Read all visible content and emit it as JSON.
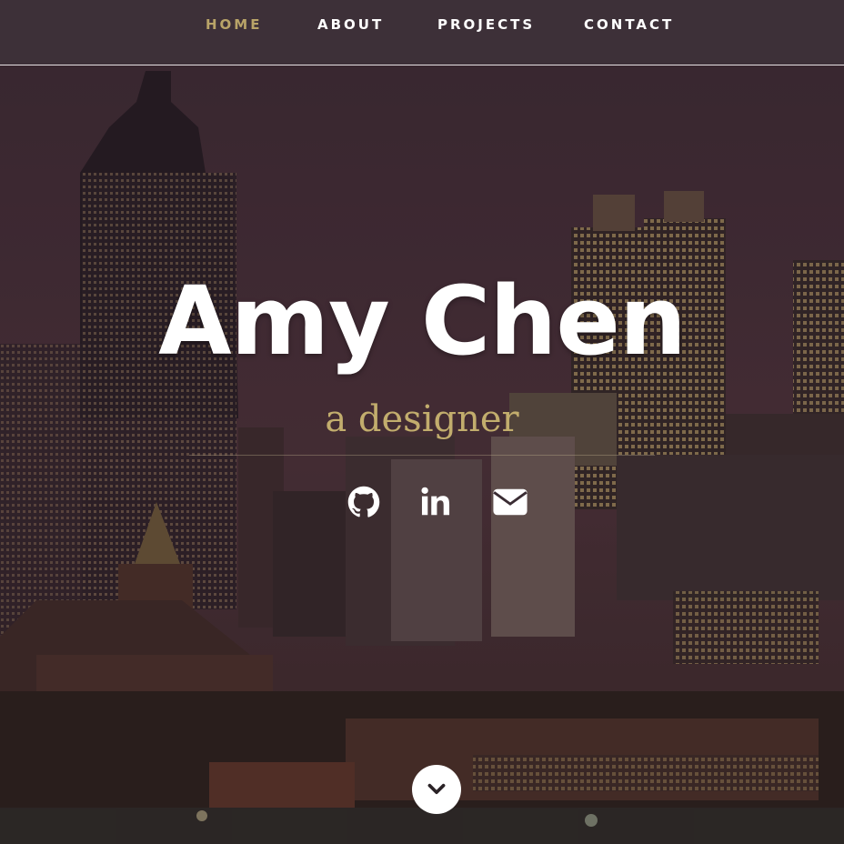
{
  "nav": {
    "items": [
      {
        "label": "HOME",
        "active": true
      },
      {
        "label": "ABOUT",
        "active": false
      },
      {
        "label": "PROJECTS",
        "active": false
      },
      {
        "label": "CONTACT",
        "active": false
      }
    ]
  },
  "hero": {
    "title": "Amy Chen",
    "subtitle": "a designer"
  },
  "social": [
    {
      "icon": "github-icon"
    },
    {
      "icon": "linkedin-icon"
    },
    {
      "icon": "email-icon"
    }
  ],
  "scroll": {
    "icon": "chevron-down-icon"
  },
  "colors": {
    "accent": "#b9a468",
    "nav_bg": "#3d3038",
    "text": "#ffffff"
  }
}
